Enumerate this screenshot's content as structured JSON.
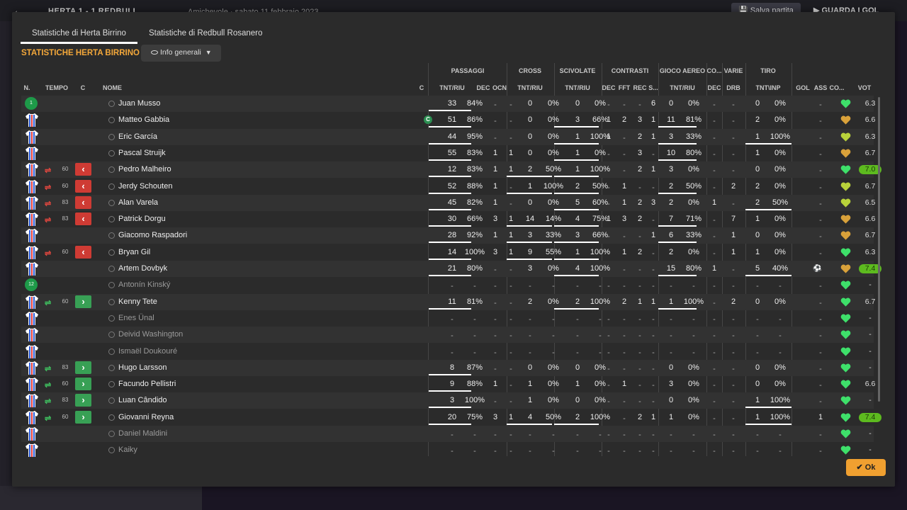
{
  "topbar": {
    "title": "HERTA 1 - 1 REDBULL",
    "date": "Amichevole · sabato 11 febbraio 2023",
    "save_label": "Salva partita",
    "watch_label": "GUARDA I GOL"
  },
  "tabs": [
    "Statistiche di Herta Birrino",
    "Statistiche di Redbull Rosanero"
  ],
  "section_title": "STATISTICHE HERTA BIRRINO",
  "view_dropdown": "Info generali",
  "ok_label": "Ok",
  "groups": [
    "PASSAGGI",
    "CROSS",
    "SCIVOLATE",
    "CONTRASTI",
    "GIOCO AEREO",
    "CO...",
    "VARIE",
    "TIRO"
  ],
  "columns": [
    "N.",
    "TEMPO",
    "C",
    "NOME",
    "C",
    "TNT/RIU",
    "DEC",
    "OCN",
    "TNT/RIU",
    "TNT/RIU",
    "DEC",
    "FFT",
    "REC",
    "S...",
    "TNT/RIU",
    "DEC",
    "DRB",
    "TNT\\INP",
    "GOL",
    "ASS",
    "CO...",
    "VOT"
  ],
  "players": [
    {
      "num": "1",
      "type": "gk",
      "name": "Juan Musso",
      "pass": [
        "33",
        "84%"
      ],
      "dec": "-",
      "ocn": "-",
      "cross": [
        "0",
        "0%"
      ],
      "tack": [
        "0",
        "0%"
      ],
      "cdec": "-",
      "fft": "-",
      "rec": "-",
      "s": "6",
      "air": [
        "0",
        "0%"
      ],
      "codec": "-",
      "drb": "-",
      "shot": [
        "0",
        "0%"
      ],
      "gol": "",
      "ass": "-",
      "heart": "green",
      "vot": "6.3",
      "good": false,
      "bars": [
        1,
        0,
        0,
        0,
        0
      ]
    },
    {
      "num": "",
      "type": "shirt",
      "name": "Matteo Gabbia",
      "captain": "C",
      "pass": [
        "51",
        "86%"
      ],
      "dec": "-",
      "ocn": "-",
      "cross": [
        "0",
        "0%"
      ],
      "tack": [
        "3",
        "66%"
      ],
      "cdec": "1",
      "fft": "2",
      "rec": "3",
      "s": "1",
      "air": [
        "11",
        "81%"
      ],
      "codec": "-",
      "drb": "-",
      "shot": [
        "2",
        "0%"
      ],
      "gol": "",
      "ass": "-",
      "heart": "orange",
      "vot": "6.6",
      "good": false,
      "bars": [
        1,
        0,
        1,
        1,
        0
      ]
    },
    {
      "num": "",
      "type": "shirt",
      "name": "Eric García",
      "pass": [
        "44",
        "95%"
      ],
      "dec": "-",
      "ocn": "-",
      "cross": [
        "0",
        "0%"
      ],
      "tack": [
        "1",
        "100%"
      ],
      "cdec": "1",
      "fft": "-",
      "rec": "2",
      "s": "1",
      "air": [
        "3",
        "33%"
      ],
      "codec": "-",
      "drb": "-",
      "shot": [
        "1",
        "100%"
      ],
      "gol": "",
      "ass": "-",
      "heart": "yellow",
      "vot": "6.3",
      "good": false,
      "bars": [
        1,
        0,
        1,
        1,
        1
      ]
    },
    {
      "num": "",
      "type": "shirt",
      "name": "Pascal Struijk",
      "pass": [
        "55",
        "83%"
      ],
      "dec": "1",
      "ocn": "1",
      "cross": [
        "0",
        "0%"
      ],
      "tack": [
        "1",
        "0%"
      ],
      "cdec": "-",
      "fft": "-",
      "rec": "3",
      "s": "-",
      "air": [
        "10",
        "80%"
      ],
      "codec": "-",
      "drb": "-",
      "shot": [
        "1",
        "0%"
      ],
      "gol": "",
      "ass": "-",
      "heart": "orange",
      "vot": "6.7",
      "good": false,
      "bars": [
        1,
        0,
        1,
        1,
        0
      ]
    },
    {
      "num": "",
      "type": "shirt",
      "name": "Pedro Malheiro",
      "sub": "out",
      "min": "60",
      "pass": [
        "12",
        "83%"
      ],
      "dec": "1",
      "ocn": "1",
      "cross": [
        "2",
        "50%"
      ],
      "tack": [
        "1",
        "100%"
      ],
      "cdec": "-",
      "fft": "-",
      "rec": "2",
      "s": "1",
      "air": [
        "3",
        "0%"
      ],
      "codec": "-",
      "drb": "-",
      "shot": [
        "0",
        "0%"
      ],
      "gol": "",
      "ass": "-",
      "heart": "green",
      "vot": "7.0",
      "good": true,
      "bars": [
        1,
        1,
        1,
        0,
        0
      ]
    },
    {
      "num": "",
      "type": "shirt",
      "name": "Jerdy Schouten",
      "sub": "out",
      "min": "60",
      "pass": [
        "52",
        "88%"
      ],
      "dec": "1",
      "ocn": "-",
      "cross": [
        "1",
        "100%"
      ],
      "tack": [
        "2",
        "50%"
      ],
      "cdec": "-",
      "fft": "1",
      "rec": "-",
      "s": "-",
      "air": [
        "2",
        "50%"
      ],
      "codec": "-",
      "drb": "2",
      "shot": [
        "2",
        "0%"
      ],
      "gol": "",
      "ass": "-",
      "heart": "yellow",
      "vot": "6.7",
      "good": false,
      "bars": [
        1,
        1,
        1,
        1,
        0
      ]
    },
    {
      "num": "",
      "type": "shirt",
      "name": "Alan Varela",
      "sub": "out",
      "min": "83",
      "pass": [
        "45",
        "82%"
      ],
      "dec": "1",
      "ocn": "-",
      "cross": [
        "0",
        "0%"
      ],
      "tack": [
        "5",
        "60%"
      ],
      "cdec": "-",
      "fft": "1",
      "rec": "2",
      "s": "3",
      "air": [
        "2",
        "0%"
      ],
      "codec": "1",
      "drb": "-",
      "shot": [
        "2",
        "50%"
      ],
      "gol": "",
      "ass": "-",
      "heart": "yellow",
      "vot": "6.5",
      "good": false,
      "bars": [
        1,
        0,
        1,
        0,
        1
      ]
    },
    {
      "num": "",
      "type": "shirt",
      "name": "Patrick Dorgu",
      "sub": "out",
      "min": "83",
      "pass": [
        "30",
        "66%"
      ],
      "dec": "3",
      "ocn": "1",
      "cross": [
        "14",
        "14%"
      ],
      "tack": [
        "4",
        "75%"
      ],
      "cdec": "1",
      "fft": "3",
      "rec": "2",
      "s": "-",
      "air": [
        "7",
        "71%"
      ],
      "codec": "-",
      "drb": "7",
      "shot": [
        "1",
        "0%"
      ],
      "gol": "",
      "ass": "-",
      "heart": "orange",
      "vot": "6.6",
      "good": false,
      "bars": [
        1,
        1,
        1,
        1,
        0
      ]
    },
    {
      "num": "",
      "type": "shirt",
      "name": "Giacomo Raspadori",
      "pass": [
        "28",
        "92%"
      ],
      "dec": "1",
      "ocn": "1",
      "cross": [
        "3",
        "33%"
      ],
      "tack": [
        "3",
        "66%"
      ],
      "cdec": "-",
      "fft": "-",
      "rec": "-",
      "s": "1",
      "air": [
        "6",
        "33%"
      ],
      "codec": "-",
      "drb": "1",
      "shot": [
        "0",
        "0%"
      ],
      "gol": "",
      "ass": "-",
      "heart": "orange",
      "vot": "6.7",
      "good": false,
      "bars": [
        1,
        1,
        1,
        1,
        0
      ]
    },
    {
      "num": "",
      "type": "shirt",
      "name": "Bryan Gil",
      "sub": "out",
      "min": "60",
      "pass": [
        "14",
        "100%"
      ],
      "dec": "3",
      "ocn": "1",
      "cross": [
        "9",
        "55%"
      ],
      "tack": [
        "1",
        "100%"
      ],
      "cdec": "-",
      "fft": "1",
      "rec": "2",
      "s": "-",
      "air": [
        "2",
        "0%"
      ],
      "codec": "-",
      "drb": "1",
      "shot": [
        "1",
        "0%"
      ],
      "gol": "",
      "ass": "-",
      "heart": "green",
      "vot": "6.3",
      "good": false,
      "bars": [
        1,
        1,
        1,
        0,
        0
      ]
    },
    {
      "num": "",
      "type": "shirt",
      "name": "Artem Dovbyk",
      "pass": [
        "21",
        "80%"
      ],
      "dec": "-",
      "ocn": "-",
      "cross": [
        "3",
        "0%"
      ],
      "tack": [
        "4",
        "100%"
      ],
      "cdec": "-",
      "fft": "-",
      "rec": "-",
      "s": "-",
      "air": [
        "15",
        "80%"
      ],
      "codec": "1",
      "drb": "-",
      "shot": [
        "5",
        "40%"
      ],
      "gol": "⚽",
      "ass": "-",
      "heart": "orange",
      "vot": "7.4",
      "good": true,
      "bars": [
        1,
        0,
        1,
        1,
        1
      ]
    },
    {
      "num": "12",
      "type": "gk",
      "name": "Antonín Kinský",
      "dim": true,
      "pass": [
        "-",
        "-"
      ],
      "dec": "-",
      "ocn": "-",
      "cross": [
        "-",
        "-"
      ],
      "tack": [
        "-",
        "-"
      ],
      "cdec": "-",
      "fft": "-",
      "rec": "-",
      "s": "-",
      "air": [
        "-",
        "-"
      ],
      "codec": "-",
      "drb": "-",
      "shot": [
        "-",
        "-"
      ],
      "gol": "",
      "ass": "-",
      "heart": "green",
      "vot": "-",
      "good": false,
      "bars": [
        0,
        0,
        0,
        0,
        0
      ]
    },
    {
      "num": "",
      "type": "shirt",
      "name": "Kenny Tete",
      "sub": "in",
      "min": "60",
      "pass": [
        "11",
        "81%"
      ],
      "dec": "-",
      "ocn": "-",
      "cross": [
        "2",
        "0%"
      ],
      "tack": [
        "2",
        "100%"
      ],
      "cdec": "-",
      "fft": "2",
      "rec": "1",
      "s": "1",
      "air": [
        "1",
        "100%"
      ],
      "codec": "-",
      "drb": "2",
      "shot": [
        "0",
        "0%"
      ],
      "gol": "",
      "ass": "-",
      "heart": "green",
      "vot": "6.7",
      "good": false,
      "bars": [
        1,
        0,
        1,
        1,
        0
      ]
    },
    {
      "num": "",
      "type": "shirt",
      "name": "Enes Ünal",
      "dim": true,
      "pass": [
        "-",
        "-"
      ],
      "dec": "-",
      "ocn": "-",
      "cross": [
        "-",
        "-"
      ],
      "tack": [
        "-",
        "-"
      ],
      "cdec": "-",
      "fft": "-",
      "rec": "-",
      "s": "-",
      "air": [
        "-",
        "-"
      ],
      "codec": "-",
      "drb": "-",
      "shot": [
        "-",
        "-"
      ],
      "gol": "",
      "ass": "-",
      "heart": "green",
      "vot": "-",
      "good": false,
      "bars": [
        0,
        0,
        0,
        0,
        0
      ]
    },
    {
      "num": "",
      "type": "shirt",
      "name": "Deivid Washington",
      "dim": true,
      "pass": [
        "-",
        "-"
      ],
      "dec": "-",
      "ocn": "-",
      "cross": [
        "-",
        "-"
      ],
      "tack": [
        "-",
        "-"
      ],
      "cdec": "-",
      "fft": "-",
      "rec": "-",
      "s": "-",
      "air": [
        "-",
        "-"
      ],
      "codec": "-",
      "drb": "-",
      "shot": [
        "-",
        "-"
      ],
      "gol": "",
      "ass": "-",
      "heart": "green",
      "vot": "-",
      "good": false,
      "bars": [
        0,
        0,
        0,
        0,
        0
      ]
    },
    {
      "num": "",
      "type": "shirt",
      "name": "Ismaël Doukouré",
      "dim": true,
      "pass": [
        "-",
        "-"
      ],
      "dec": "-",
      "ocn": "-",
      "cross": [
        "-",
        "-"
      ],
      "tack": [
        "-",
        "-"
      ],
      "cdec": "-",
      "fft": "-",
      "rec": "-",
      "s": "-",
      "air": [
        "-",
        "-"
      ],
      "codec": "-",
      "drb": "-",
      "shot": [
        "-",
        "-"
      ],
      "gol": "",
      "ass": "-",
      "heart": "green",
      "vot": "-",
      "good": false,
      "bars": [
        0,
        0,
        0,
        0,
        0
      ]
    },
    {
      "num": "",
      "type": "shirt",
      "name": "Hugo Larsson",
      "sub": "in",
      "min": "83",
      "pass": [
        "8",
        "87%"
      ],
      "dec": "-",
      "ocn": "-",
      "cross": [
        "0",
        "0%"
      ],
      "tack": [
        "0",
        "0%"
      ],
      "cdec": "-",
      "fft": "-",
      "rec": "-",
      "s": "-",
      "air": [
        "0",
        "0%"
      ],
      "codec": "-",
      "drb": "-",
      "shot": [
        "0",
        "0%"
      ],
      "gol": "",
      "ass": "-",
      "heart": "green",
      "vot": "-",
      "good": false,
      "bars": [
        1,
        0,
        0,
        0,
        0
      ]
    },
    {
      "num": "",
      "type": "shirt",
      "name": "Facundo Pellistri",
      "sub": "in",
      "min": "60",
      "pass": [
        "9",
        "88%"
      ],
      "dec": "1",
      "ocn": "-",
      "cross": [
        "1",
        "0%"
      ],
      "tack": [
        "1",
        "0%"
      ],
      "cdec": "-",
      "fft": "1",
      "rec": "-",
      "s": "-",
      "air": [
        "3",
        "0%"
      ],
      "codec": "-",
      "drb": "-",
      "shot": [
        "0",
        "0%"
      ],
      "gol": "",
      "ass": "-",
      "heart": "green",
      "vot": "6.6",
      "good": false,
      "bars": [
        1,
        0,
        0,
        0,
        0
      ]
    },
    {
      "num": "",
      "type": "shirt",
      "name": "Luan Cândido",
      "sub": "in",
      "min": "83",
      "pass": [
        "3",
        "100%"
      ],
      "dec": "-",
      "ocn": "-",
      "cross": [
        "1",
        "0%"
      ],
      "tack": [
        "0",
        "0%"
      ],
      "cdec": "-",
      "fft": "-",
      "rec": "-",
      "s": "-",
      "air": [
        "0",
        "0%"
      ],
      "codec": "-",
      "drb": "-",
      "shot": [
        "1",
        "100%"
      ],
      "gol": "",
      "ass": "-",
      "heart": "green",
      "vot": "-",
      "good": false,
      "bars": [
        1,
        0,
        0,
        0,
        1
      ]
    },
    {
      "num": "",
      "type": "shirt",
      "name": "Giovanni Reyna",
      "sub": "in",
      "min": "60",
      "pass": [
        "20",
        "75%"
      ],
      "dec": "3",
      "ocn": "1",
      "cross": [
        "4",
        "50%"
      ],
      "tack": [
        "2",
        "100%"
      ],
      "cdec": "-",
      "fft": "-",
      "rec": "2",
      "s": "1",
      "air": [
        "1",
        "0%"
      ],
      "codec": "-",
      "drb": "-",
      "shot": [
        "1",
        "100%"
      ],
      "gol": "",
      "ass": "1",
      "heart": "green",
      "vot": "7.4",
      "good": true,
      "bars": [
        1,
        1,
        1,
        0,
        1
      ]
    },
    {
      "num": "",
      "type": "shirt",
      "name": "Daniel Maldini",
      "dim": true,
      "pass": [
        "-",
        "-"
      ],
      "dec": "-",
      "ocn": "-",
      "cross": [
        "-",
        "-"
      ],
      "tack": [
        "-",
        "-"
      ],
      "cdec": "-",
      "fft": "-",
      "rec": "-",
      "s": "-",
      "air": [
        "-",
        "-"
      ],
      "codec": "-",
      "drb": "-",
      "shot": [
        "-",
        "-"
      ],
      "gol": "",
      "ass": "-",
      "heart": "green",
      "vot": "-",
      "good": false,
      "bars": [
        0,
        0,
        0,
        0,
        0
      ]
    },
    {
      "num": "",
      "type": "shirt",
      "name": "Kaiky",
      "dim": true,
      "pass": [
        "-",
        "-"
      ],
      "dec": "-",
      "ocn": "-",
      "cross": [
        "-",
        "-"
      ],
      "tack": [
        "-",
        "-"
      ],
      "cdec": "-",
      "fft": "-",
      "rec": "-",
      "s": "-",
      "air": [
        "-",
        "-"
      ],
      "codec": "-",
      "drb": "-",
      "shot": [
        "-",
        "-"
      ],
      "gol": "",
      "ass": "-",
      "heart": "green",
      "vot": "-",
      "good": false,
      "bars": [
        0,
        0,
        0,
        0,
        0
      ]
    }
  ]
}
